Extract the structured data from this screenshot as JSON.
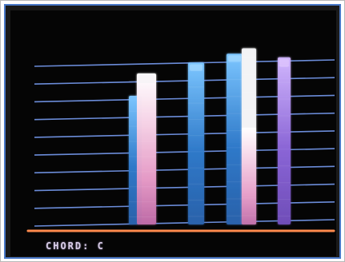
{
  "status": {
    "chord_label": "CHORD: C"
  },
  "colors": {
    "background": "#050505",
    "string_line": "#7ea4ff",
    "floor_line": "#ff8a4d",
    "bar_blue": "#3a7dcf",
    "bar_pink": "#e7a3c8",
    "bar_white": "#f6f3f6",
    "bar_purple": "#8b6ad6"
  },
  "strings": {
    "count": 10
  },
  "bars": [
    {
      "name": "bar-1",
      "level": 0.84
    },
    {
      "name": "bar-2",
      "level": 0.9
    },
    {
      "name": "bar-3",
      "level": 0.95
    },
    {
      "name": "bar-4",
      "level": 0.98
    },
    {
      "name": "bar-5",
      "level": 0.93
    }
  ]
}
